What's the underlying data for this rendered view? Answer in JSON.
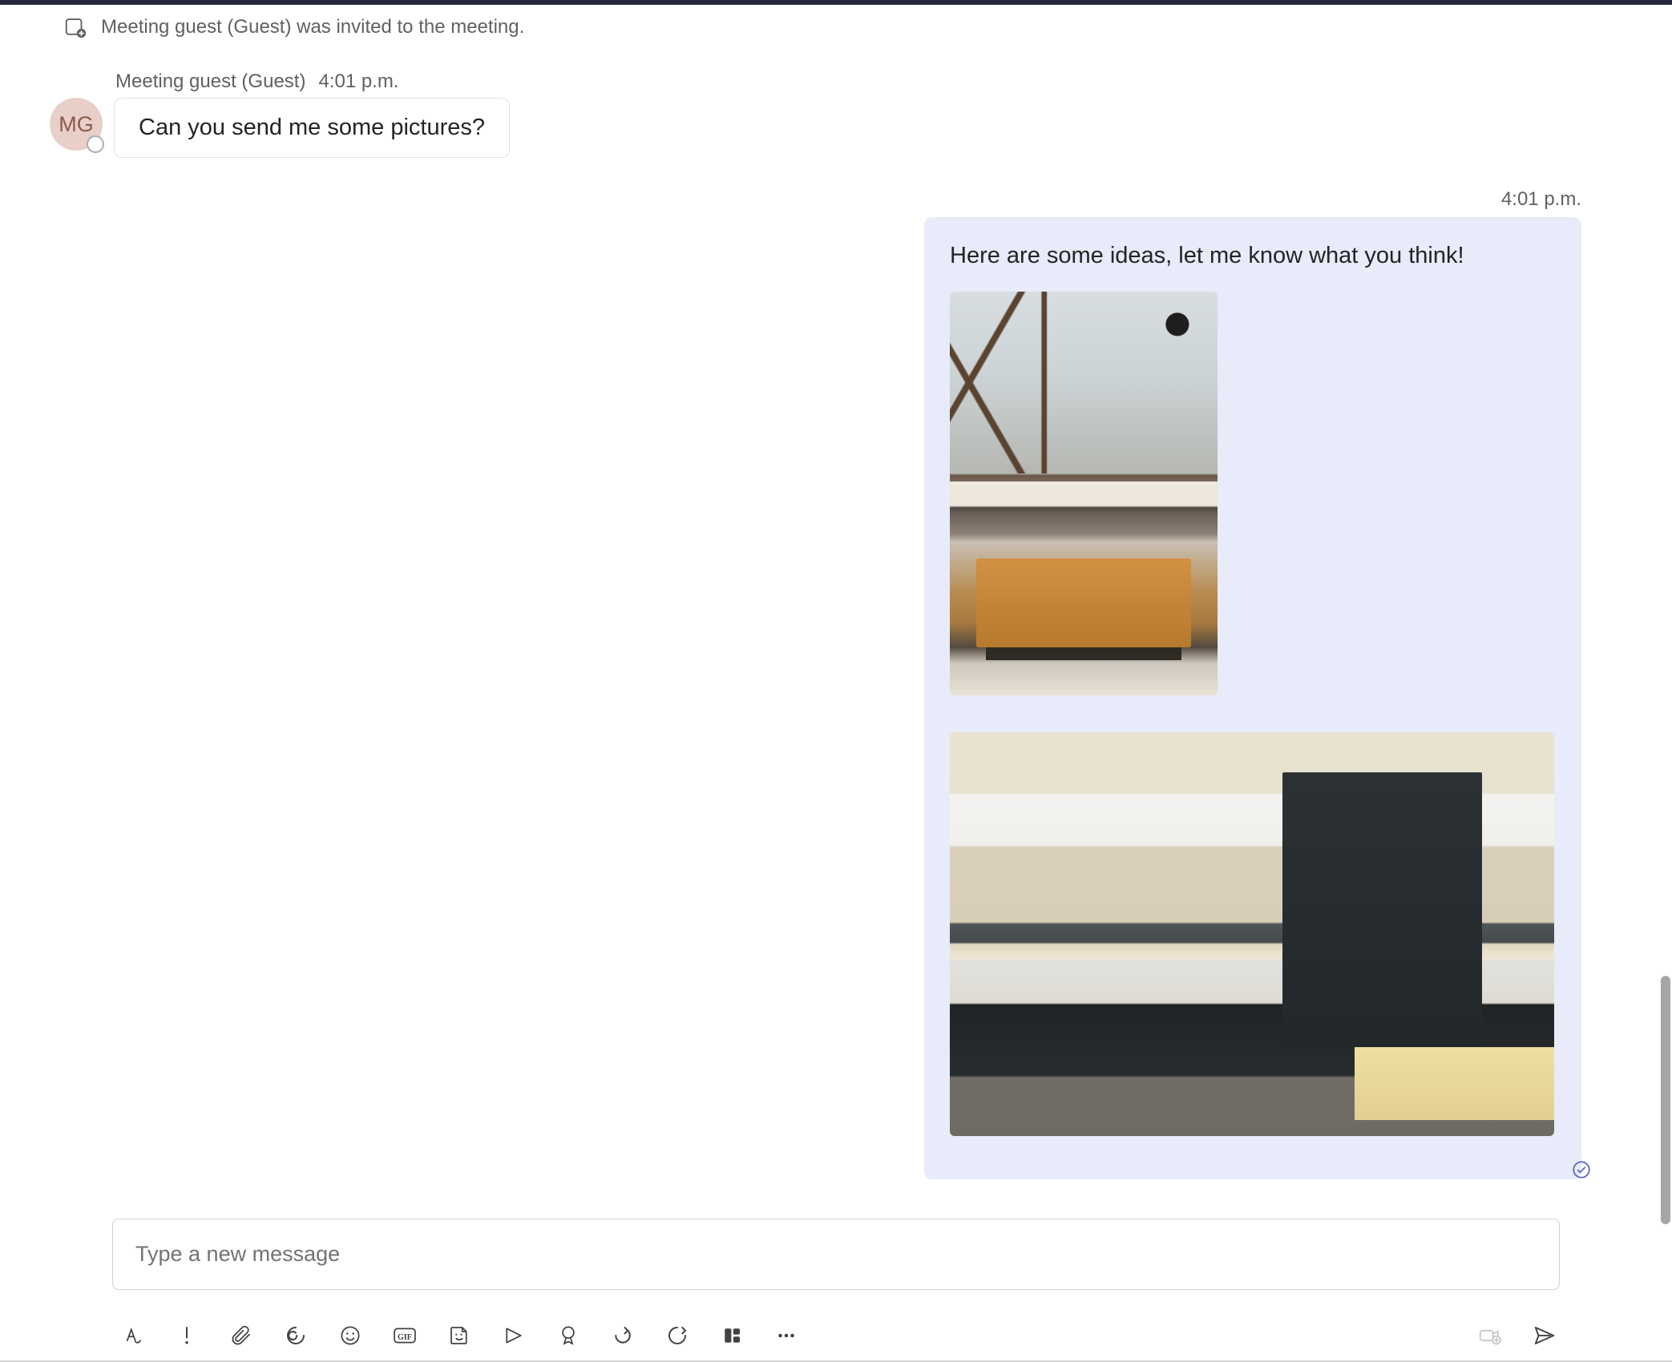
{
  "system_message": "Meeting guest (Guest) was invited to the meeting.",
  "received": {
    "sender": "Meeting guest (Guest)",
    "time": "4:01 p.m.",
    "avatar_initials": "MG",
    "text": "Can you send me some pictures?"
  },
  "sent": {
    "time": "4:01 p.m.",
    "text": "Here are some ideas, let me know what you think!",
    "attachments": [
      "living-room-photo",
      "kitchen-photo"
    ],
    "seen": true
  },
  "composer": {
    "placeholder": "Type a new message"
  },
  "toolbar_icons": [
    "format-text",
    "priority",
    "attach",
    "loop",
    "emoji",
    "gif",
    "sticker",
    "share-tab",
    "approvals",
    "viva",
    "stream",
    "actions-more"
  ],
  "toolbar_right": [
    "video-clip",
    "send"
  ]
}
